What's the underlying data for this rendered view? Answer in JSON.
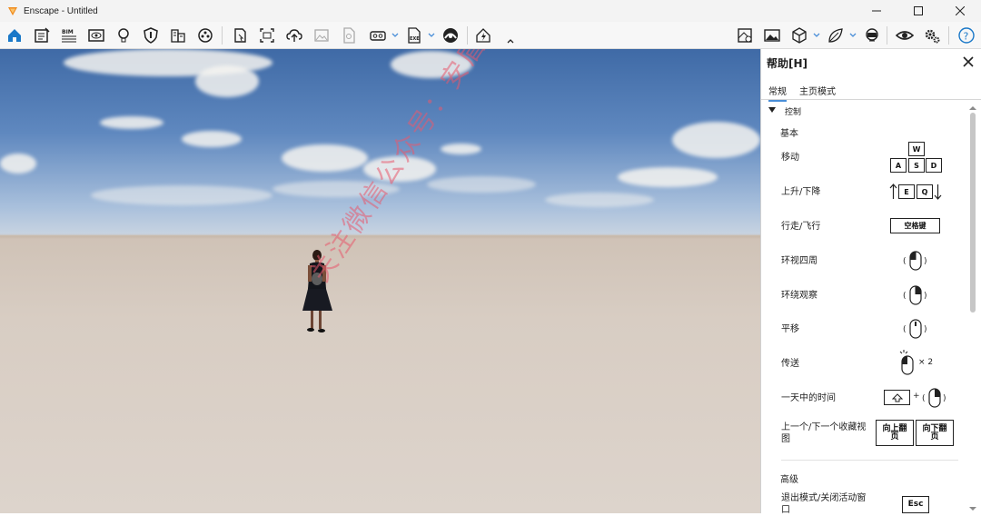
{
  "window": {
    "title": "Enscape - Untitled",
    "controls": [
      "minimize-icon",
      "maximize-icon",
      "close-icon"
    ]
  },
  "toolbar": {
    "left_icons": [
      "home-icon",
      "notes-icon",
      "bim-icon",
      "viewport-icon",
      "light-icon",
      "shield-icon",
      "buildings-icon",
      "video-icon",
      "screenshot-icon",
      "batch-render-icon",
      "upload-icon",
      "image-icon",
      "file-icon",
      "vr-headset-icon",
      "exe-icon",
      "web-icon",
      "lightning-icon"
    ],
    "bim_label": "BIM",
    "exe_label": "EXE",
    "right_icons": [
      "map-icon",
      "picture-icon",
      "cube-icon",
      "leaf-icon",
      "vr-icon",
      "eye-icon",
      "settings-icon",
      "help-icon"
    ]
  },
  "viewport": {
    "watermark": "关注微信公众号：安盾软件管家"
  },
  "panel": {
    "title": "帮助[H]",
    "tabs": [
      "常规",
      "主页模式"
    ],
    "section_control": "控制",
    "section_basic": "基本",
    "rows": [
      {
        "label": "移动"
      },
      {
        "label": "上升/下降"
      },
      {
        "label": "行走/飞行"
      },
      {
        "label": "环视四周"
      },
      {
        "label": "环绕观察"
      },
      {
        "label": "平移"
      },
      {
        "label": "传送"
      },
      {
        "label": "一天中的时间"
      },
      {
        "label": "上一个/下一个收藏视图"
      }
    ],
    "keys": {
      "w": "W",
      "a": "A",
      "s": "S",
      "d": "D",
      "e": "E",
      "q": "Q",
      "space": "空格键",
      "prev_view": "向上翻页",
      "next_view": "向下翻页",
      "esc": "Esc"
    },
    "times_two": "× 2",
    "plus": "+",
    "section_advanced": "高级",
    "advanced_row": "退出模式/关闭活动窗口"
  }
}
